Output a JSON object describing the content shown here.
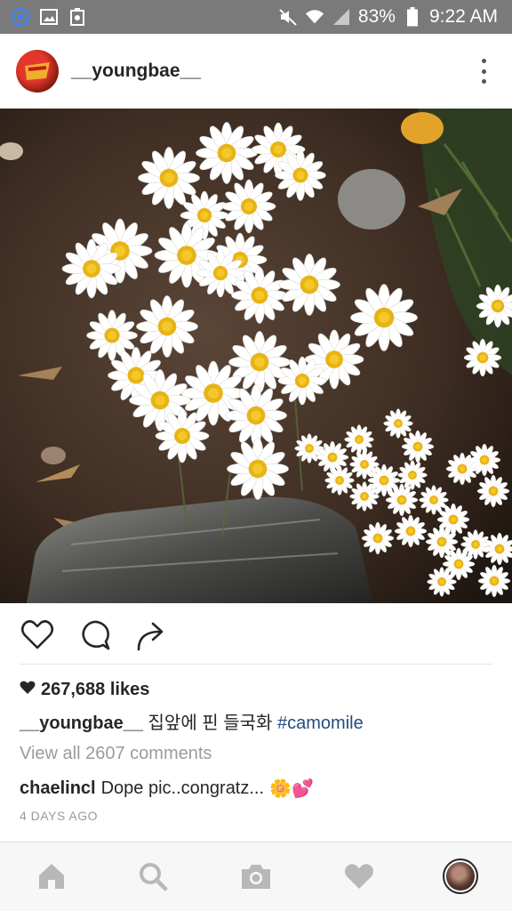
{
  "status_bar": {
    "battery": "83%",
    "time": "9:22 AM",
    "icons": [
      "chrome-icon",
      "image-icon",
      "screenshot-icon",
      "mute-icon",
      "wifi-icon",
      "signal-icon",
      "battery-icon"
    ]
  },
  "post": {
    "username": "__youngbae__",
    "likes": "267,688 likes",
    "caption_user": "__youngbae__",
    "caption_text": "집앞에 핀 들국화",
    "caption_hashtag": "#camomile",
    "view_all": "View all 2607 comments",
    "comment_user": "chaelincl",
    "comment_text": "Dope pic..congratz...",
    "comment_emoji": "🌼💕",
    "time_ago": "4 DAYS AGO"
  },
  "colors": {
    "status_bar_bg": "#7a7a7a",
    "hashtag": "#234d7e",
    "muted_text": "#9b9b9b",
    "nav_bg": "#f7f7f7"
  },
  "bottom_nav": {
    "items": [
      "home-icon",
      "search-icon",
      "camera-icon",
      "heart-icon",
      "profile-avatar"
    ]
  }
}
